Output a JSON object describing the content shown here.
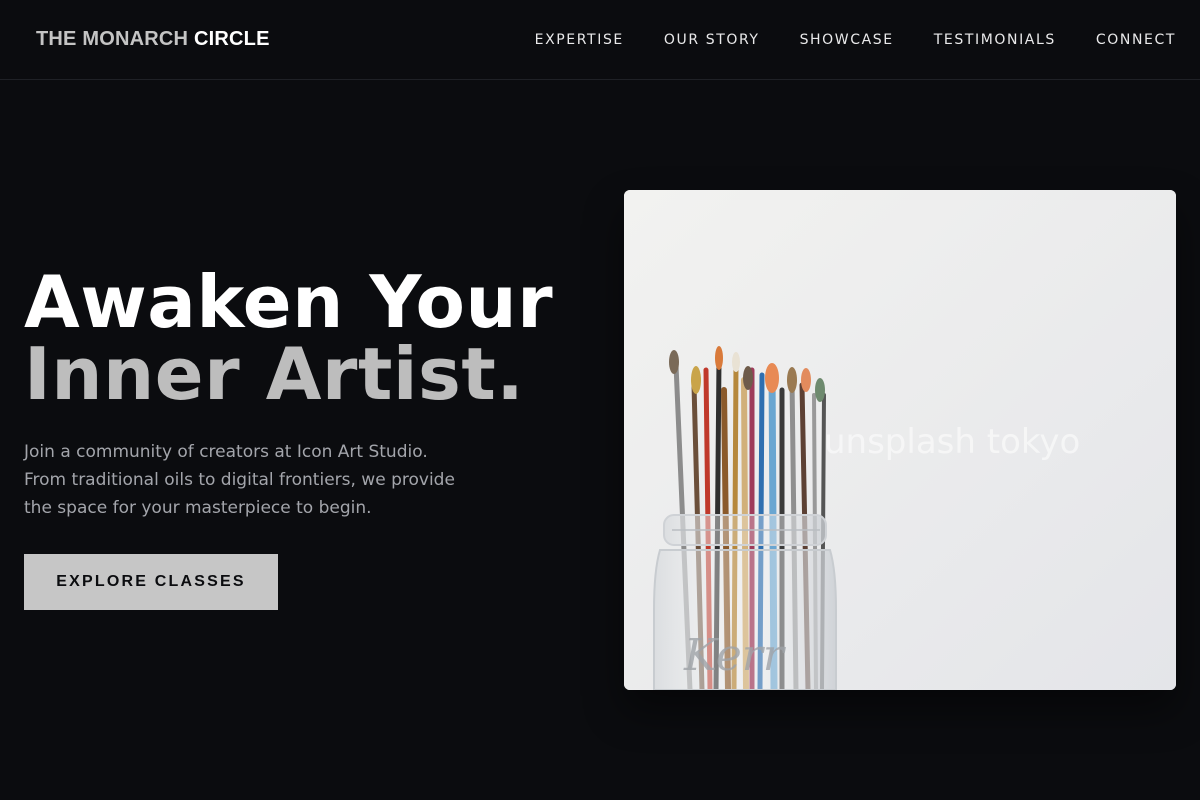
{
  "header": {
    "logo_part1": "THE MONARCH",
    "logo_part2": "CIRCLE",
    "nav": [
      {
        "label": "EXPERTISE"
      },
      {
        "label": "OUR STORY"
      },
      {
        "label": "SHOWCASE"
      },
      {
        "label": "TESTIMONIALS"
      },
      {
        "label": "CONNECT"
      }
    ]
  },
  "hero": {
    "title_line1": "Awaken Your",
    "title_line2": "Inner Artist.",
    "description": "Join a community of creators at Icon Art Studio. From traditional oils to digital frontiers, we provide the space for your masterpiece to begin.",
    "cta_label": "EXPLORE CLASSES",
    "image": {
      "subject": "paint brushes in a glass mason jar",
      "watermark": "unsplash tokyo"
    }
  },
  "colors": {
    "background": "#0b0c0f",
    "accent_button": "#c6c6c6",
    "title_secondary": "#bdbdbd",
    "body_text": "#a3a5ab"
  }
}
